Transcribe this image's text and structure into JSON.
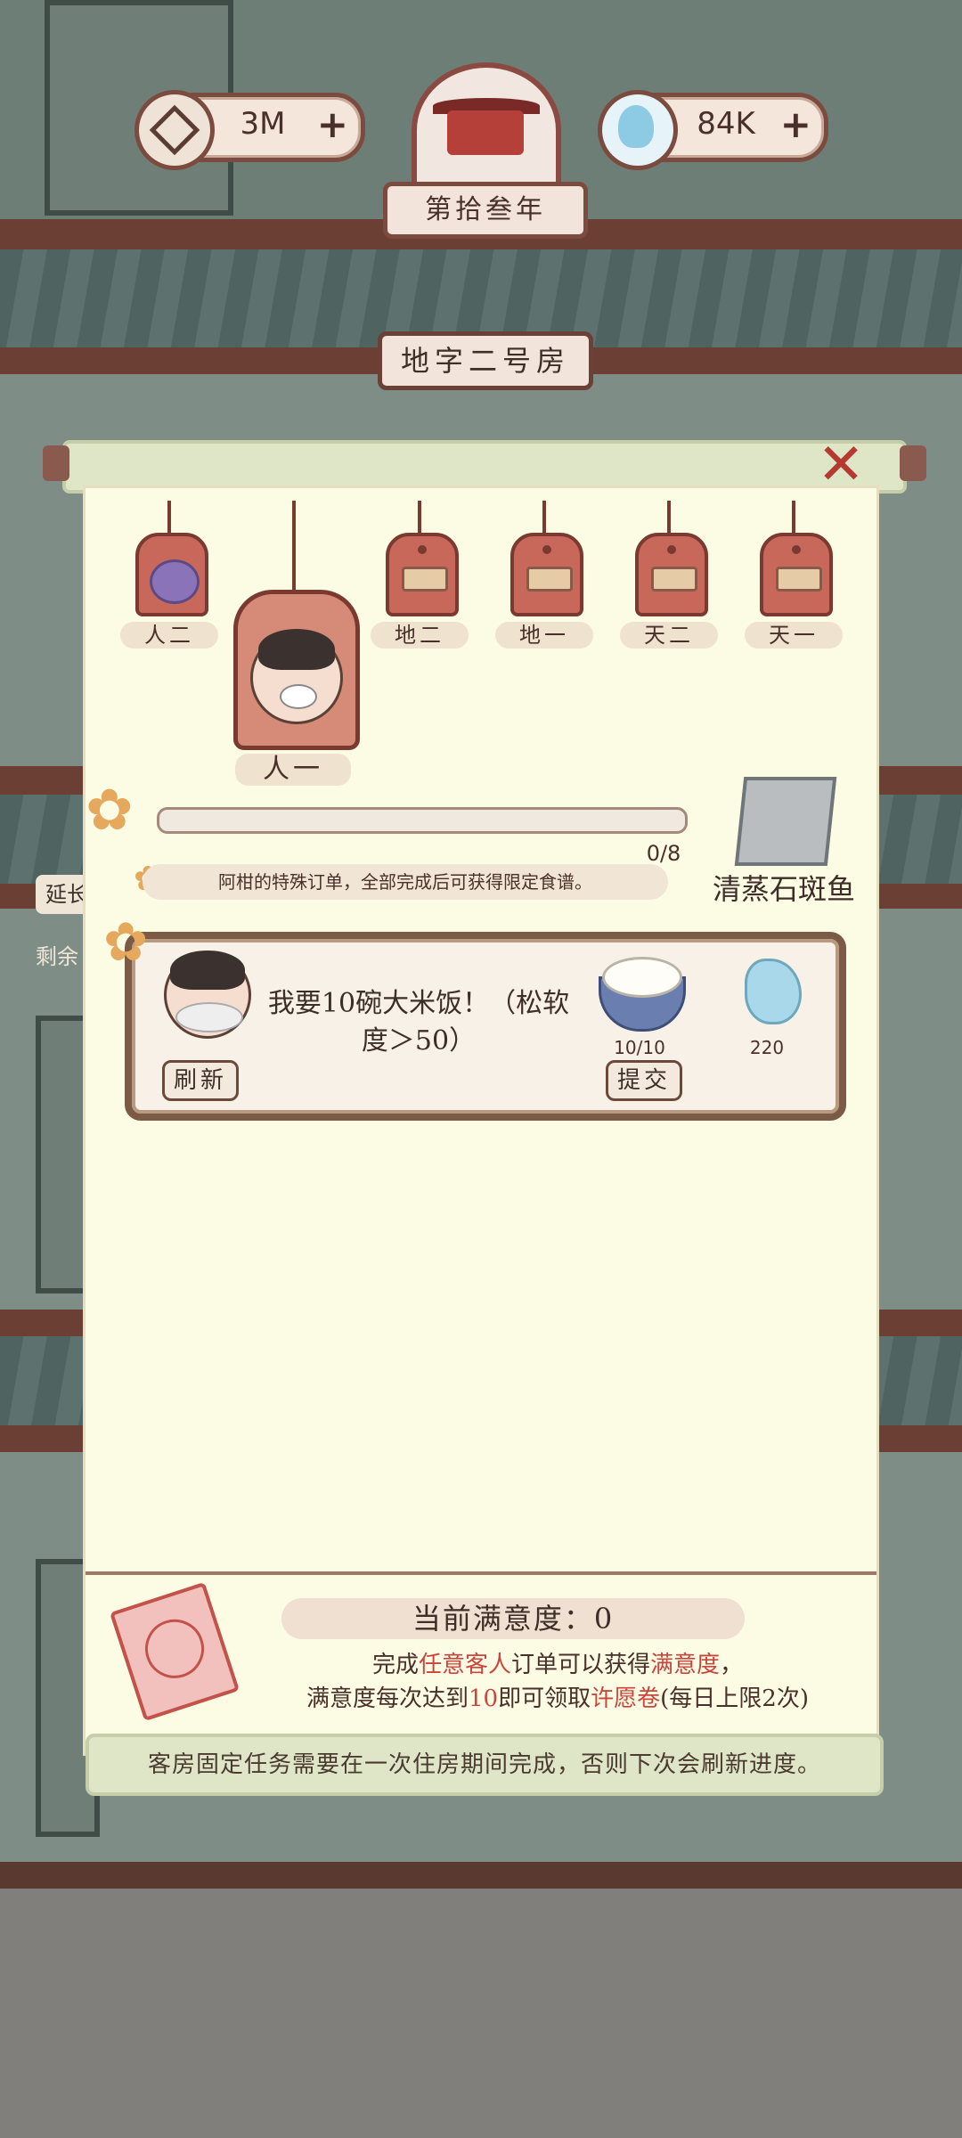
{
  "hud": {
    "currency_coins": "3M",
    "currency_spirit": "84K",
    "year_label": "第拾叁年"
  },
  "room": {
    "name": "地字二号房"
  },
  "panel": {
    "tags": [
      {
        "label": "人二",
        "state": "unlocked"
      },
      {
        "label": "人一",
        "state": "selected"
      },
      {
        "label": "地二",
        "state": "locked"
      },
      {
        "label": "地一",
        "state": "locked"
      },
      {
        "label": "天二",
        "state": "locked"
      },
      {
        "label": "天一",
        "state": "locked"
      }
    ],
    "progress": {
      "current": 0,
      "total": 8,
      "text": "0/8"
    },
    "special_order_note": "阿柑的特殊订单，全部完成后可获得限定食谱。",
    "reward_name": "清蒸石斑鱼",
    "order": {
      "request_text": "我要10碗大米饭！（松软度＞50）",
      "refresh_label": "刷新",
      "submit_label": "提交",
      "item_count": "10/10",
      "reward_amount": "220"
    },
    "satisfaction": {
      "title": "当前满意度：0",
      "line1_prefix": "完成",
      "line1_hl1": "任意客人",
      "line1_mid": "订单可以获得",
      "line1_hl2": "满意度",
      "line1_suffix": "，",
      "line2_prefix": "满意度每次达到",
      "line2_hl1": "10",
      "line2_mid": "即可领取",
      "line2_hl2": "许愿卷",
      "line2_suffix": "(每日上限2次)"
    },
    "footer_note": "客房固定任务需要在一次住房期间完成，否则下次会刷新进度。"
  },
  "background_text": {
    "side_tab_1": "延长",
    "side_tab_2": "剩余"
  },
  "colors": {
    "accent_red": "#c8463c",
    "panel_bg": "#fcfbe4",
    "wood": "#6b3f33"
  }
}
